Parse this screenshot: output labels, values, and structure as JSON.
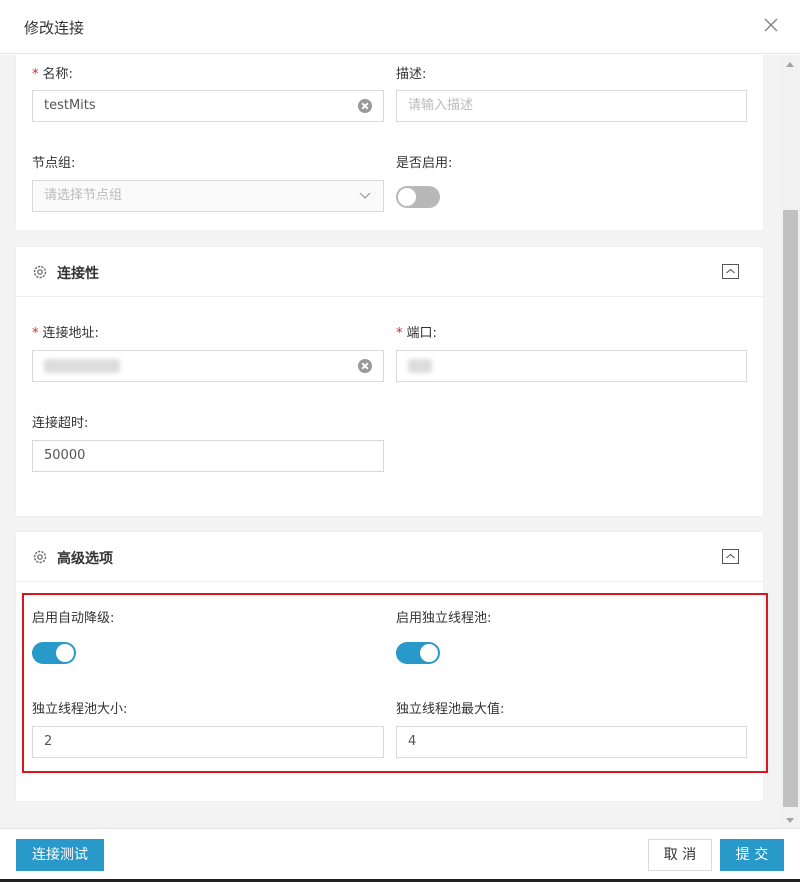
{
  "dialog": {
    "title": "修改连接"
  },
  "basic": {
    "name_label": "名称:",
    "name_value": "testMits",
    "desc_label": "描述:",
    "desc_placeholder": "请输入描述",
    "group_label": "节点组:",
    "group_placeholder": "请选择节点组",
    "enabled_label": "是否启用:",
    "enabled": false
  },
  "connectivity": {
    "title": "连接性",
    "address_label": "连接地址:",
    "port_label": "端口:",
    "timeout_label": "连接超时:",
    "timeout_value": "50000"
  },
  "advanced": {
    "title": "高级选项",
    "auto_degrade_label": "启用自动降级:",
    "auto_degrade": true,
    "own_pool_label": "启用独立线程池:",
    "own_pool": true,
    "pool_size_label": "独立线程池大小:",
    "pool_size_value": "2",
    "pool_max_label": "独立线程池最大值:",
    "pool_max_value": "4"
  },
  "footer": {
    "test_label": "连接测试",
    "cancel_label": "取 消",
    "submit_label": "提 交"
  },
  "colors": {
    "primary": "#2899c8",
    "required": "#e02020",
    "highlight": "#d9161d"
  }
}
